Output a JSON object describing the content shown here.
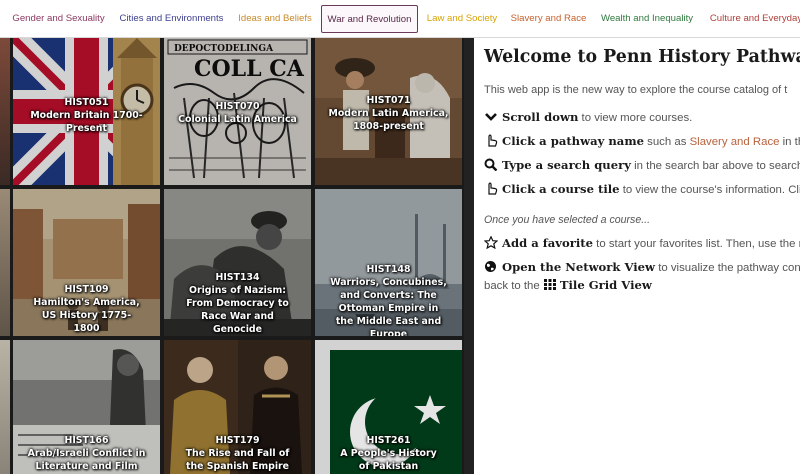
{
  "nav": {
    "tabs": [
      {
        "label": "Gender and Sexuality",
        "color": "#8b3a62"
      },
      {
        "label": "Cities and Environments",
        "color": "#3c3f8f"
      },
      {
        "label": "Ideas and Beliefs",
        "color": "#c98a2b"
      },
      {
        "label": "War and Revolution",
        "color": "#5a2a4a",
        "active": true
      },
      {
        "label": "Law and Society",
        "color": "#d9a400"
      },
      {
        "label": "Slavery and Race",
        "color": "#c4622d"
      },
      {
        "label": "Wealth and Inequality",
        "color": "#2f7a3e"
      },
      {
        "label": "Culture and Everyday",
        "color": "#b0403a"
      }
    ]
  },
  "tiles": [
    {
      "code": "HIST051",
      "title": "Modern Britain 1700-Present",
      "image": "union-jack-big-ben"
    },
    {
      "code": "HIST070",
      "title": "Colonial Latin America",
      "image": "colonial-woodcut"
    },
    {
      "code": "HIST071",
      "title": "Modern Latin America, 1808-present",
      "image": "revolutionary-soldiers"
    },
    {
      "code": "HIST109",
      "title": "Hamilton's America, US History 1775-1800",
      "image": "early-american-street"
    },
    {
      "code": "HIST134",
      "title": "Origins of Nazism: From Democracy to Race War and Genocide",
      "image": "historical-photo"
    },
    {
      "code": "HIST148",
      "title": "Warriors, Concubines, and Converts: The Ottoman Empire in the Middle East and Europe",
      "image": "istanbul-skyline"
    },
    {
      "code": "HIST166",
      "title": "Arab/Israeli Conflict in Literature and Film",
      "image": "crowd-photo"
    },
    {
      "code": "HIST179",
      "title": "The Rise and Fall of the Spanish Empire",
      "image": "tudor-portraits"
    },
    {
      "code": "HIST261",
      "title": "A People's History of Pakistan",
      "image": "pakistan-flag"
    }
  ],
  "welcome": {
    "title": "Welcome to Penn History Pathways!",
    "intro": "This web app is the new way to explore the course catalog of t",
    "scroll_bold": "Scroll down",
    "scroll_rest": " to view more courses.",
    "pathway_bold": "Click a pathway name",
    "pathway_rest1": " such as ",
    "pathway_link": "Slavery and Race",
    "pathway_rest2": " in the s",
    "search_bold": "Type a search query",
    "search_rest": " in the search bar above to search c",
    "tile_bold": "Click a course tile",
    "tile_rest": " to view the course's information. Click",
    "selected_note": "Once you have selected a course...",
    "fav_bold": "Add a favorite",
    "fav_rest": " to start your favorites list. Then, use the re",
    "network_bold": "Open the Network View",
    "network_rest": " to visualize the pathway conne",
    "back_text": "back to the ",
    "grid_bold": "Tile Grid View"
  },
  "colors": {
    "link": "#b8623d",
    "active_border": "#6a3a5c"
  }
}
